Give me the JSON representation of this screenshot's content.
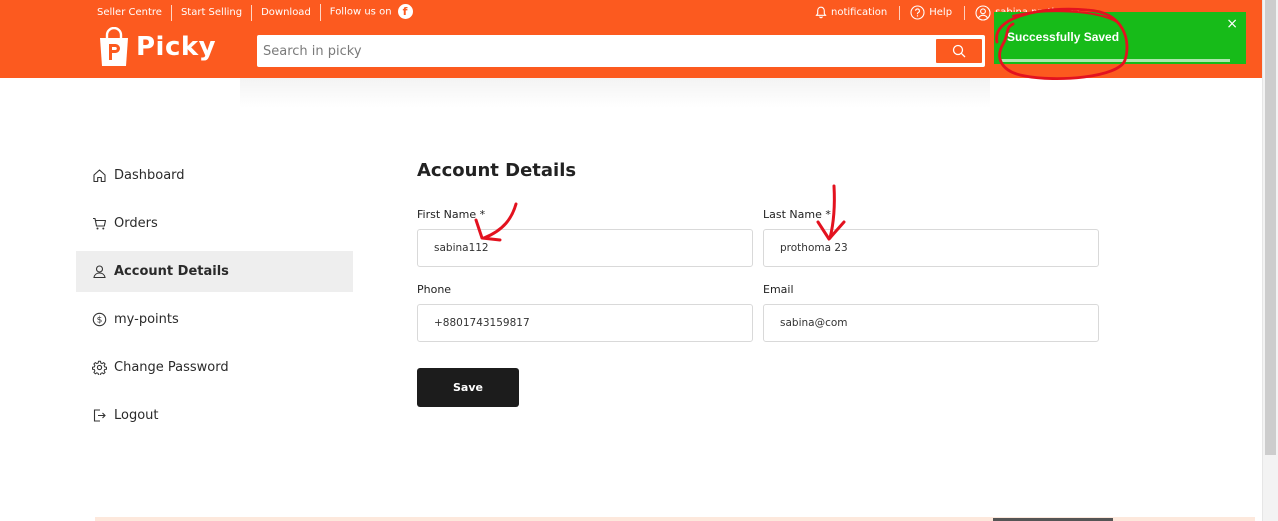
{
  "header": {
    "top_links": [
      "Seller Centre",
      "Start Selling",
      "Download",
      "Follow us on"
    ],
    "facebook_glyph": "f",
    "notification": "notification",
    "help": "Help",
    "user": "sabina prothoma",
    "brand": "Picky",
    "search_placeholder": "Search in picky",
    "brand_color": "#fc5a1f"
  },
  "toast": {
    "message": "Successfully Saved",
    "close": "×",
    "color": "#17bb19"
  },
  "sidebar": {
    "items": [
      {
        "label": "Dashboard",
        "icon": "home-icon"
      },
      {
        "label": "Orders",
        "icon": "cart-icon"
      },
      {
        "label": "Account Details",
        "icon": "user-icon",
        "active": true
      },
      {
        "label": "my-points",
        "icon": "dollar-icon"
      },
      {
        "label": "Change Password",
        "icon": "gear-icon"
      },
      {
        "label": "Logout",
        "icon": "logout-icon"
      }
    ]
  },
  "form": {
    "title": "Account Details",
    "first_name_label": "First Name *",
    "first_name_value": "sabina112",
    "last_name_label": "Last Name *",
    "last_name_value": "prothoma 23",
    "phone_label": "Phone",
    "phone_value": "+8801743159817",
    "email_label": "Email",
    "email_value": "sabina@com",
    "save_label": "Save"
  }
}
